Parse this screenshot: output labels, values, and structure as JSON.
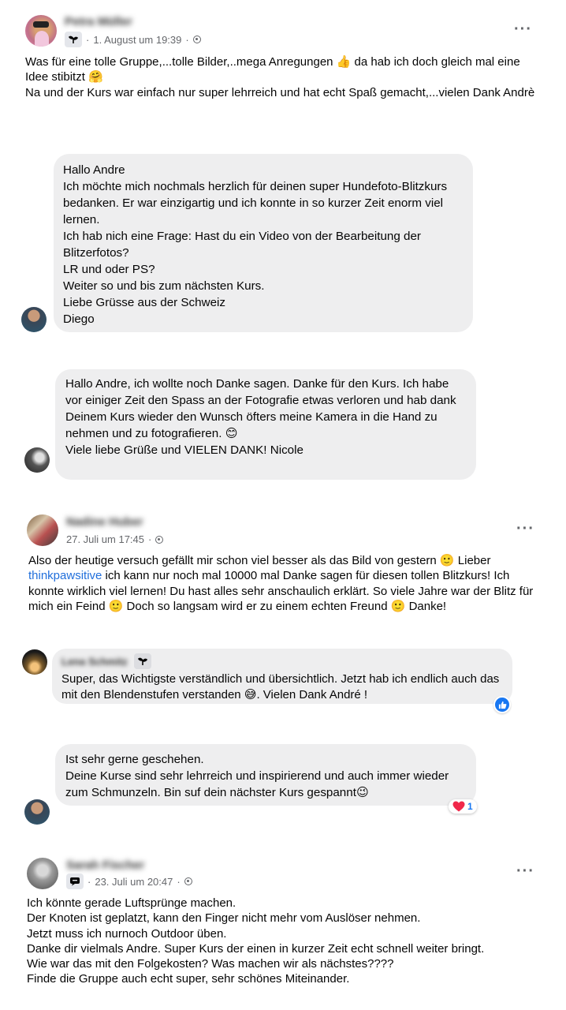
{
  "posts": [
    {
      "author": "Petra Müller",
      "timestamp": "1. August um 19:39",
      "text": "Was für eine tolle Gruppe,...tolle Bilder,..mega Anregungen 👍 da hab ich doch gleich mal eine Idee stibitzt 🤗\nNa und der Kurs war einfach nur super lehrreich und hat echt Spaß gemacht,...vielen Dank Andrè"
    },
    {
      "author": "Nadine Huber",
      "timestamp": "27. Juli um 17:45",
      "text_before_link": "Also der heutige versuch gefällt mir schon viel besser als das Bild von gestern 🙂 Lieber ",
      "link": "thinkpawsitive",
      "text_after_link": " ich kann nur noch mal 10000 mal Danke sagen für diesen tollen Blitzkurs! Ich konnte wirklich viel lernen! Du hast alles sehr anschaulich erklärt. So viele Jahre war der Blitz für mich ein Feind 🙂 Doch so langsam wird er zu einem echten Freund 🙂 Danke!"
    },
    {
      "author": "Sarah Fischer",
      "timestamp": "23. Juli um 20:47",
      "text": "Ich könnte gerade Luftsprünge machen.\nDer Knoten ist geplatzt, kann den Finger nicht mehr vom Auslöser nehmen.\nJetzt muss ich nurnoch Outdoor üben.\nDanke dir vielmals Andre. Super Kurs der einen in kurzer Zeit echt schnell weiter bringt.\nWie war das mit den Folgekosten? Was machen wir als nächstes????\nFinde die Gruppe auch echt super, sehr schönes Miteinander."
    }
  ],
  "messages": [
    {
      "text": "Hallo Andre\nIch möchte mich nochmals herzlich für deinen super Hundefoto-Blitzkurs bedanken. Er war einzigartig und ich konnte in so kurzer Zeit enorm viel lernen.\nIch hab nich eine Frage: Hast du ein Video von der Bearbeitung der Blitzerfotos?\nLR und oder PS?\nWeiter so und bis zum nächsten Kurs.\nLiebe Grüsse aus der Schweiz\nDiego"
    },
    {
      "text": "Hallo Andre, ich wollte noch Danke sagen. Danke für den Kurs. Ich habe vor einiger Zeit den Spass an der Fotografie etwas verloren und hab dank Deinem Kurs wieder den Wunsch öfters meine Kamera in die Hand zu nehmen und zu fotografieren. 😊\nViele liebe Grüße und VIELEN DANK! Nicole"
    },
    {
      "text": "Ist sehr gerne geschehen.\nDeine Kurse sind sehr lehrreich und inspirierend und auch immer wieder zum Schmunzeln. Bin suf dein nächster Kurs gespannt😉",
      "reaction_count": "1"
    }
  ],
  "comment": {
    "author": "Lena Schmitz",
    "text": "Super, das Wichtigste verständlich und übersichtlich. Jetzt hab ich endlich auch das mit den Blendenstufen verstanden 😅. Vielen Dank André !"
  },
  "icons": {
    "more": "more-options-icon",
    "globe": "globe-icon",
    "badge": "member-badge-icon",
    "like": "like-reaction-icon",
    "heart": "heart-reaction-icon"
  },
  "colors": {
    "link": "#216fdb",
    "bubble": "#eeeeef",
    "like": "#1877f2",
    "heart": "#f0284a"
  }
}
